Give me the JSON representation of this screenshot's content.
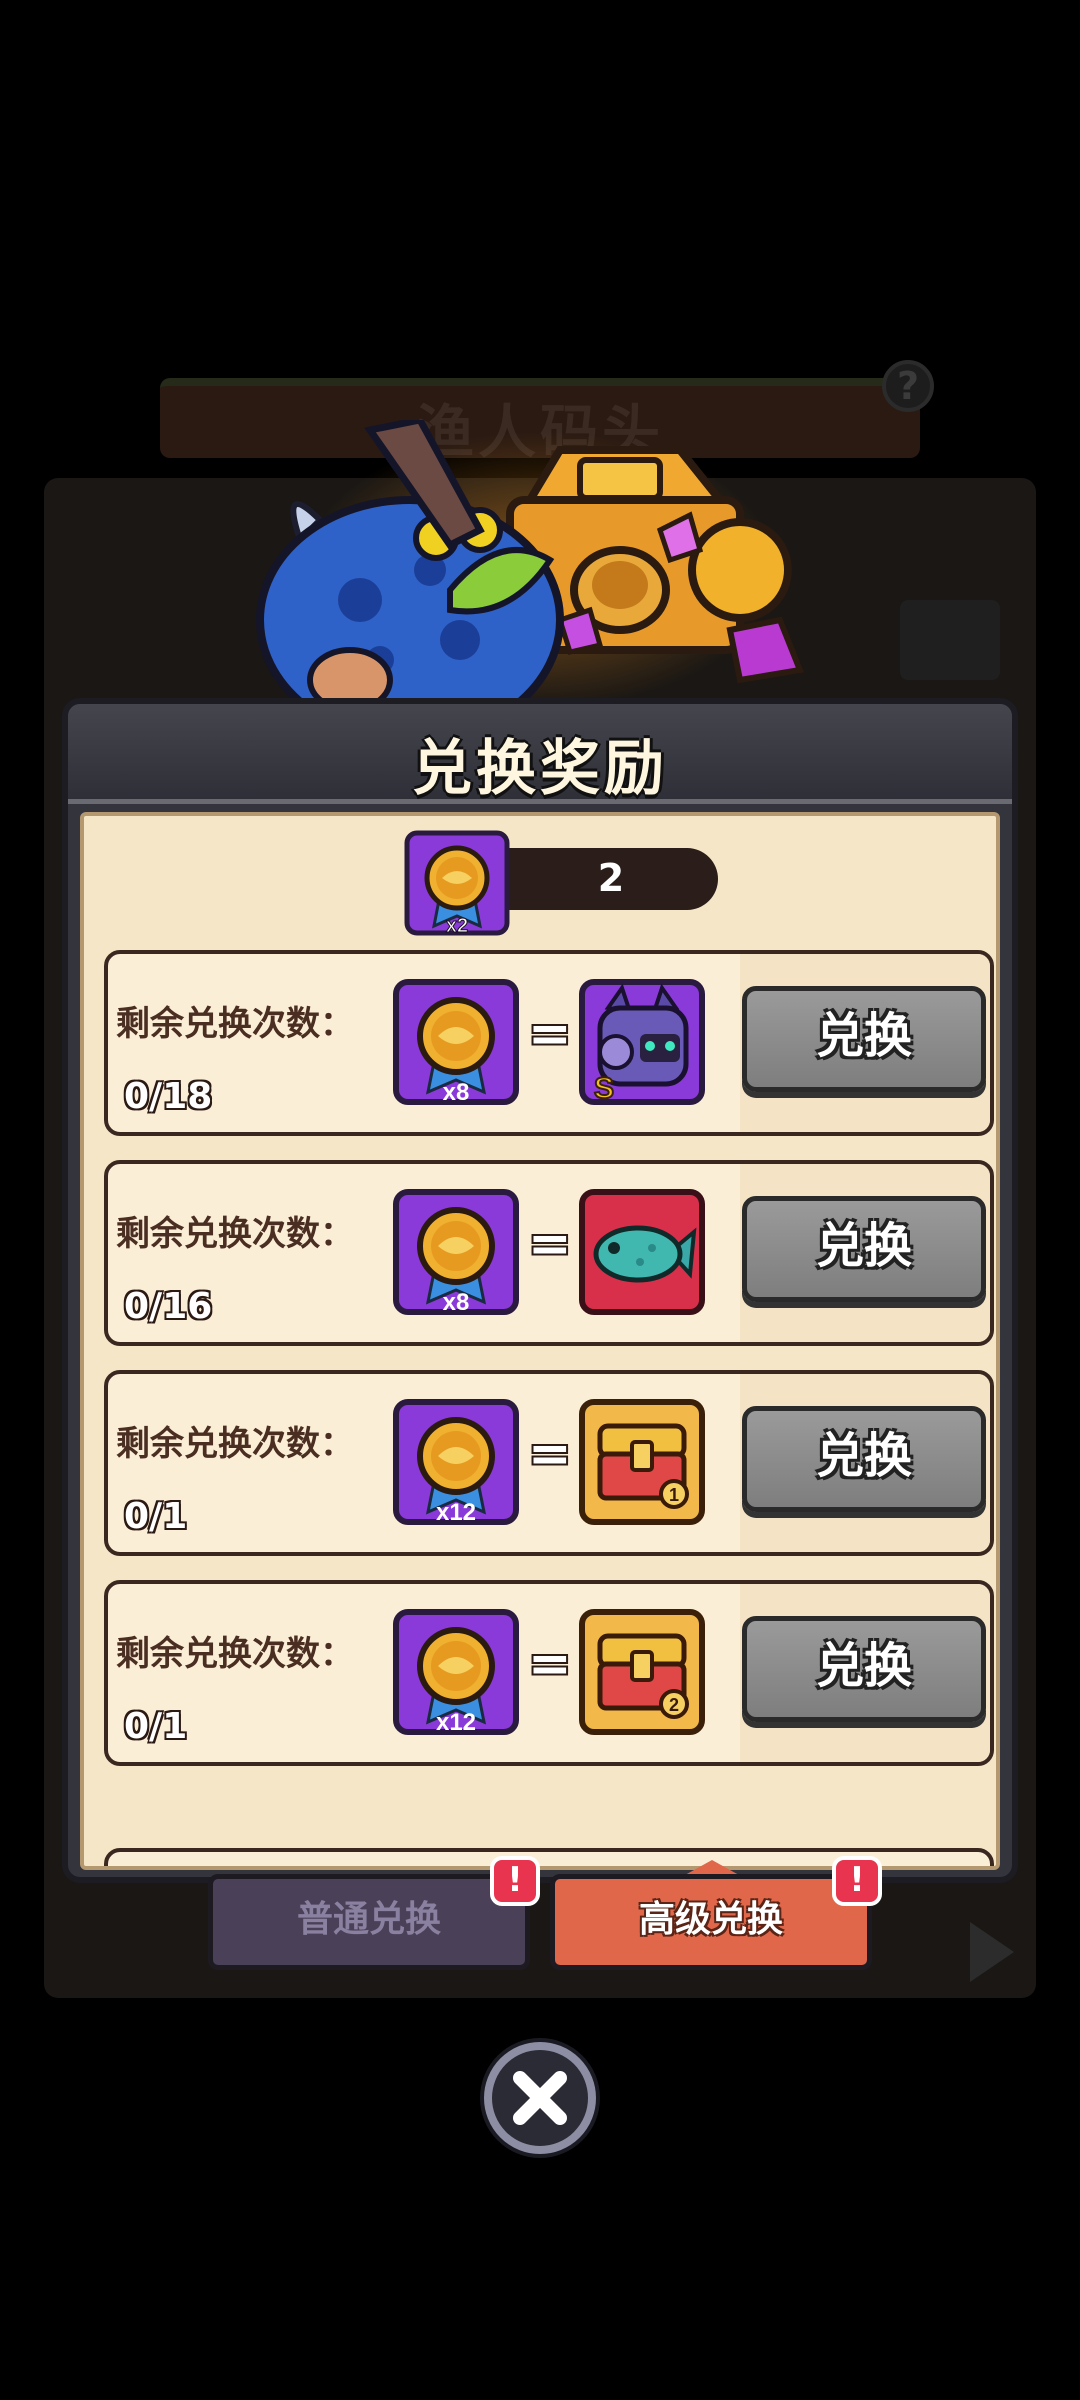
{
  "background": {
    "location_title": "渔人码头",
    "help_glyph": "?"
  },
  "modal": {
    "title": "兑换奖励",
    "currency": {
      "icon": "gold-fish-medal-icon",
      "icon_count": "x2",
      "value": "2"
    },
    "rows": [
      {
        "label": "剩余兑换次数：",
        "count": "0/18",
        "cost_icon": "gold-fish-medal-icon",
        "cost_qty": "x8",
        "reward_icon": "purple-robot-cat-s-rank-icon",
        "reward_badge": "S",
        "button": "兑换"
      },
      {
        "label": "剩余兑换次数：",
        "count": "0/16",
        "cost_icon": "gold-fish-medal-icon",
        "cost_qty": "x8",
        "reward_icon": "teal-fish-icon",
        "button": "兑换"
      },
      {
        "label": "剩余兑换次数：",
        "count": "0/1",
        "cost_icon": "gold-fish-medal-icon",
        "cost_qty": "x12",
        "reward_icon": "golden-chest-tier-1-icon",
        "button": "兑换"
      },
      {
        "label": "剩余兑换次数：",
        "count": "0/1",
        "cost_icon": "gold-fish-medal-icon",
        "cost_qty": "x12",
        "reward_icon": "golden-chest-tier-2-icon",
        "button": "兑换"
      }
    ]
  },
  "tabs": [
    {
      "label": "普通兑换",
      "alert": "!",
      "active": false
    },
    {
      "label": "高级兑换",
      "alert": "!",
      "active": true
    }
  ],
  "colors": {
    "panel_cream": "#f5e6c8",
    "button_gray": "#8a8a8a",
    "tab_active": "#e0674a",
    "tab_inactive": "#4a4058",
    "alert_red": "#e8344e",
    "medal_purple": "#8a3ad8"
  }
}
